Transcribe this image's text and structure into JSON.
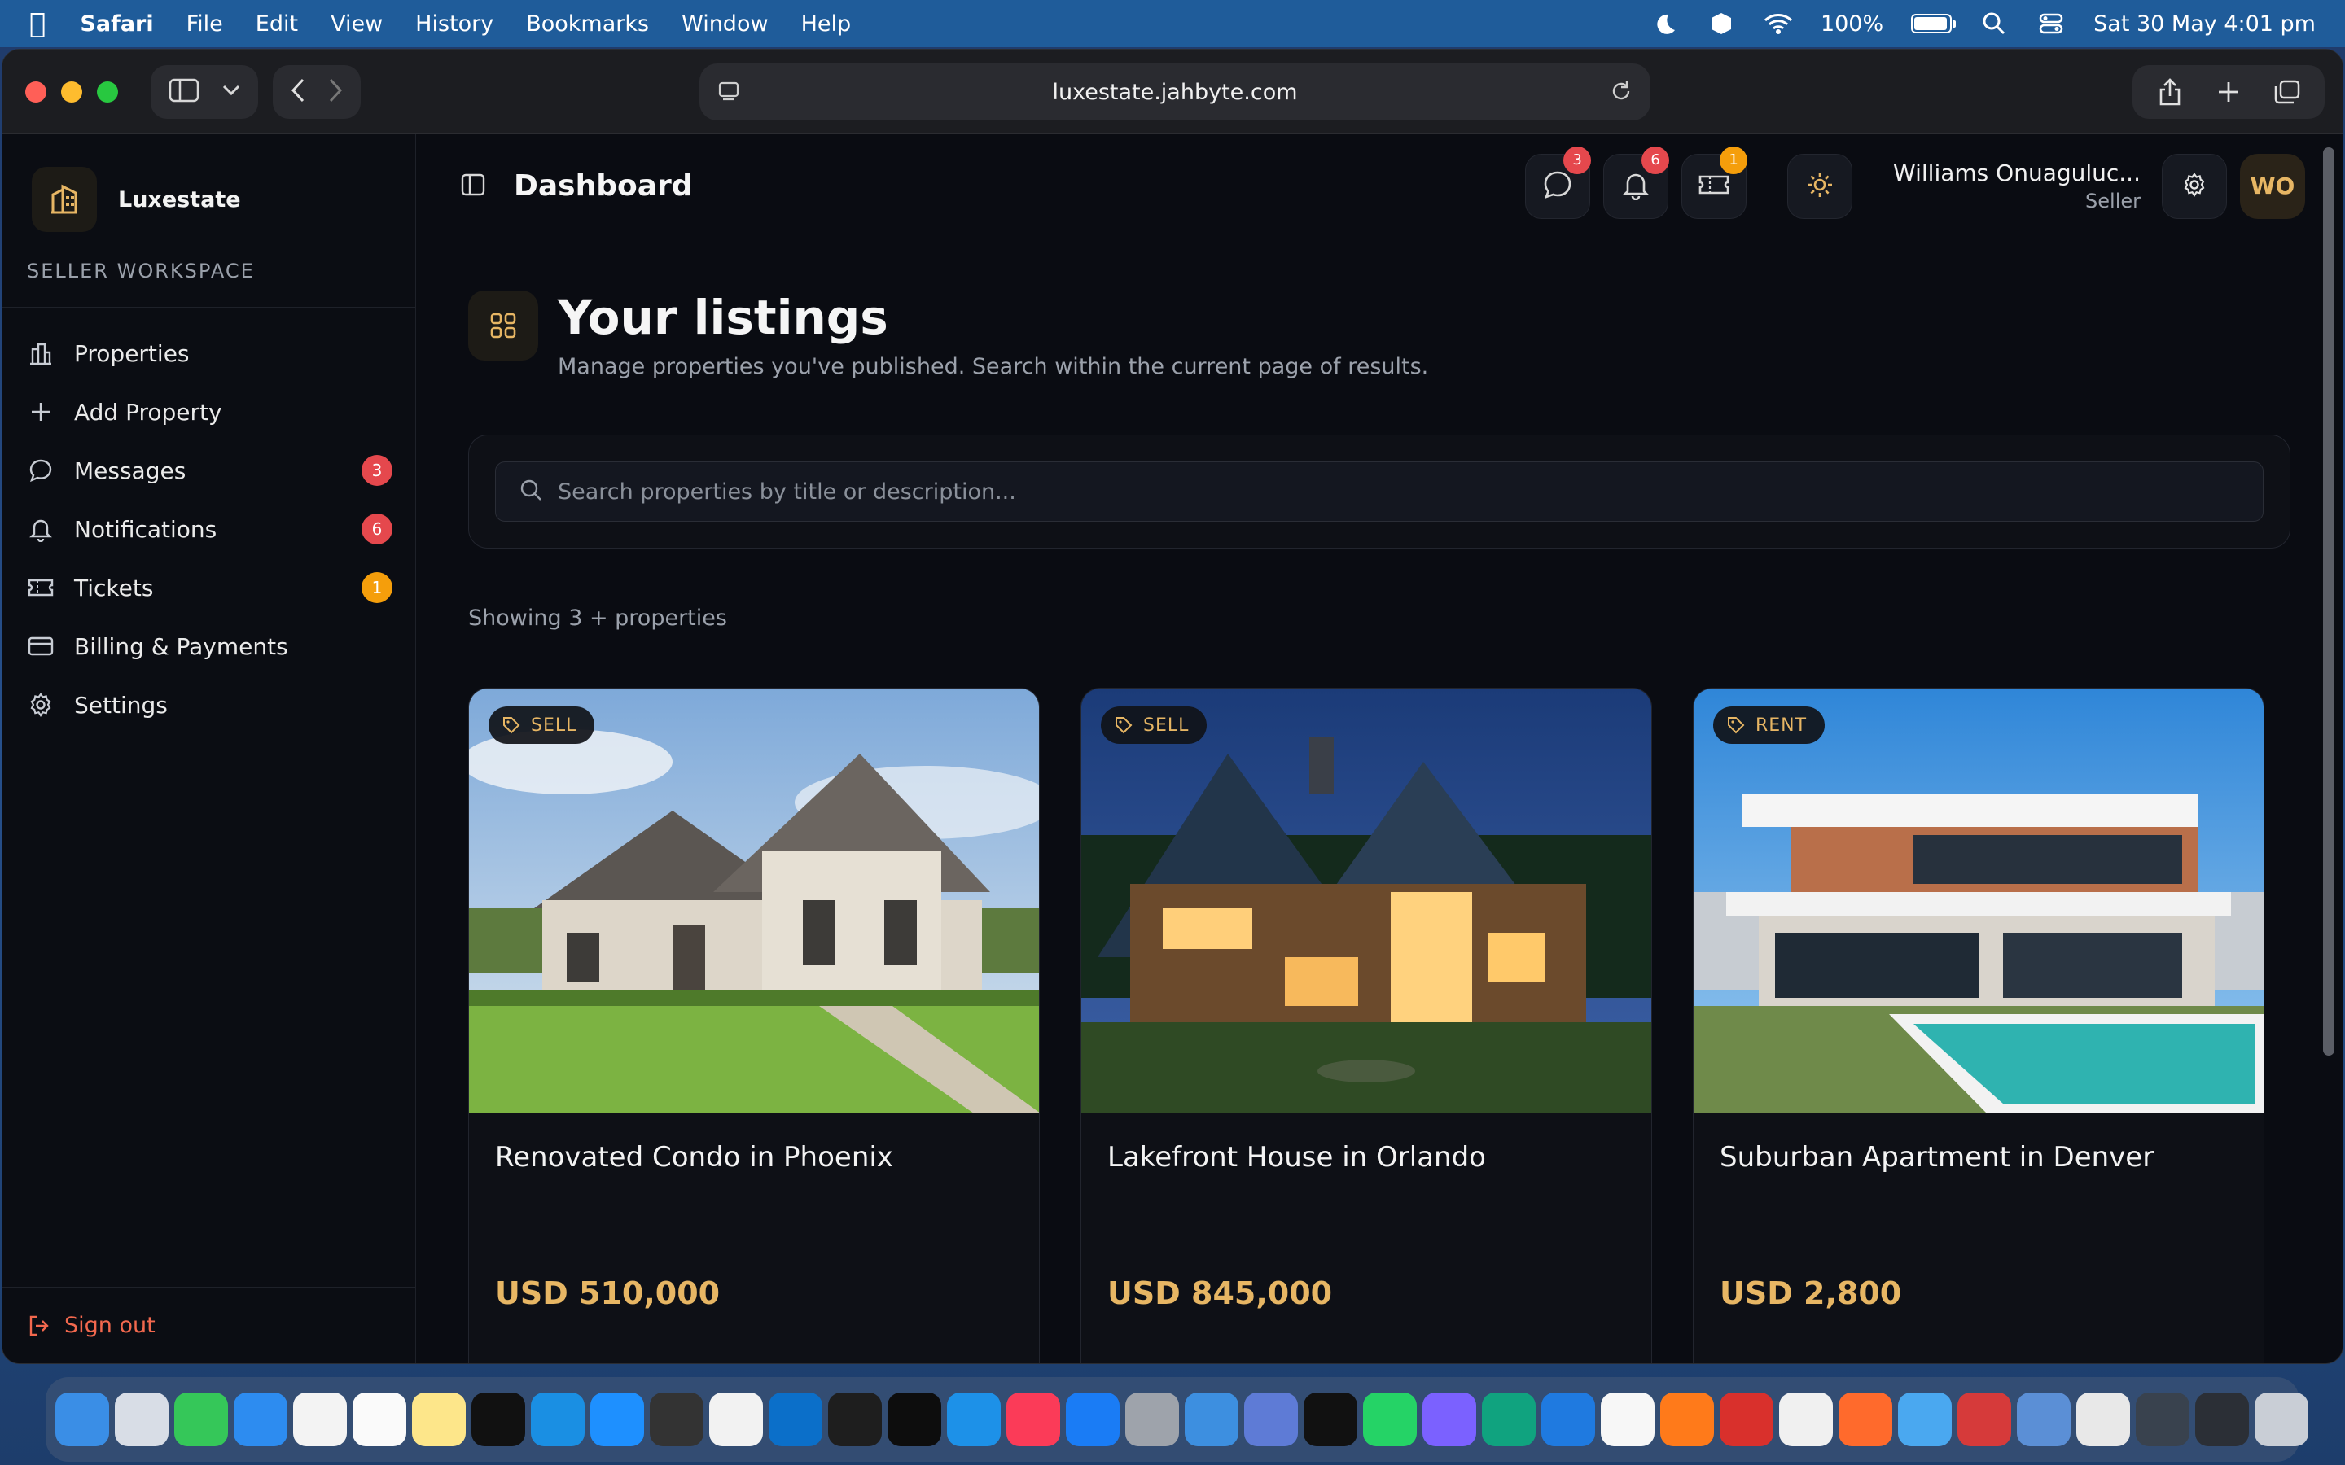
{
  "menubar": {
    "app": "Safari",
    "items": [
      "File",
      "Edit",
      "View",
      "History",
      "Bookmarks",
      "Window",
      "Help"
    ],
    "battery": "100%",
    "datetime": "Sat 30 May  4:01 pm"
  },
  "browser": {
    "url": "luxestate.jahbyte.com"
  },
  "sidebar": {
    "brand": "Luxestate",
    "workspace": "SELLER WORKSPACE",
    "items": [
      {
        "label": "Properties",
        "icon": "bar-chart-icon"
      },
      {
        "label": "Add Property",
        "icon": "plus-icon"
      },
      {
        "label": "Messages",
        "icon": "message-icon",
        "count": "3",
        "count_color": "#e5484d"
      },
      {
        "label": "Notifications",
        "icon": "bell-icon",
        "count": "6",
        "count_color": "#e5484d"
      },
      {
        "label": "Tickets",
        "icon": "ticket-icon",
        "count": "1",
        "count_color": "#f59e0b"
      },
      {
        "label": "Billing & Payments",
        "icon": "card-icon"
      },
      {
        "label": "Settings",
        "icon": "gear-icon"
      }
    ],
    "signout": "Sign out"
  },
  "topbar": {
    "title": "Dashboard",
    "badges": {
      "messages": "3",
      "notifications": "6",
      "tickets": "1"
    },
    "user_name": "Williams Onuaguluc...",
    "user_role": "Seller",
    "avatar": "WO"
  },
  "content": {
    "title": "Your listings",
    "subtitle": "Manage properties you've published. Search within the current page of results.",
    "search_placeholder": "Search properties by title or description...",
    "showing": "Showing 3 + properties",
    "cards": [
      {
        "tag": "SELL",
        "title": "Renovated Condo in Phoenix",
        "price": "USD 510,000"
      },
      {
        "tag": "SELL",
        "title": "Lakefront House in Orlando",
        "price": "USD 845,000"
      },
      {
        "tag": "RENT",
        "title": "Suburban Apartment in Denver",
        "price": "USD 2,800"
      }
    ]
  },
  "colors": {
    "accent": "#e7b664",
    "danger": "#e5484d",
    "warning": "#f59e0b",
    "signout": "#f2684e"
  }
}
